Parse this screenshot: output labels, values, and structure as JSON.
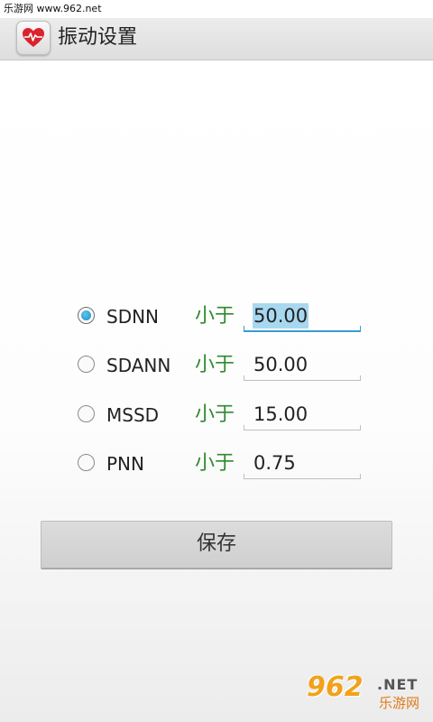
{
  "status_bar": {
    "text": "乐游网 www.962.net"
  },
  "app": {
    "title": "振动设置",
    "icon": "heart-pulse-icon",
    "icon_color": "#d9232e"
  },
  "settings": {
    "rows": [
      {
        "label": "SDNN",
        "condition": "小于",
        "value": "50.00",
        "checked": true
      },
      {
        "label": "SDANN",
        "condition": "小于",
        "value": "50.00",
        "checked": false
      },
      {
        "label": "MSSD",
        "condition": "小于",
        "value": "15.00",
        "checked": false
      },
      {
        "label": "PNN",
        "condition": "小于",
        "value": "0.75",
        "checked": false
      }
    ]
  },
  "save_button": {
    "label": "保存"
  },
  "watermark": {
    "number": "962",
    "suffix": ".NET",
    "text": "乐游网"
  },
  "colors": {
    "condition_text": "#2e8b2e",
    "accent": "#3a9bd4"
  }
}
